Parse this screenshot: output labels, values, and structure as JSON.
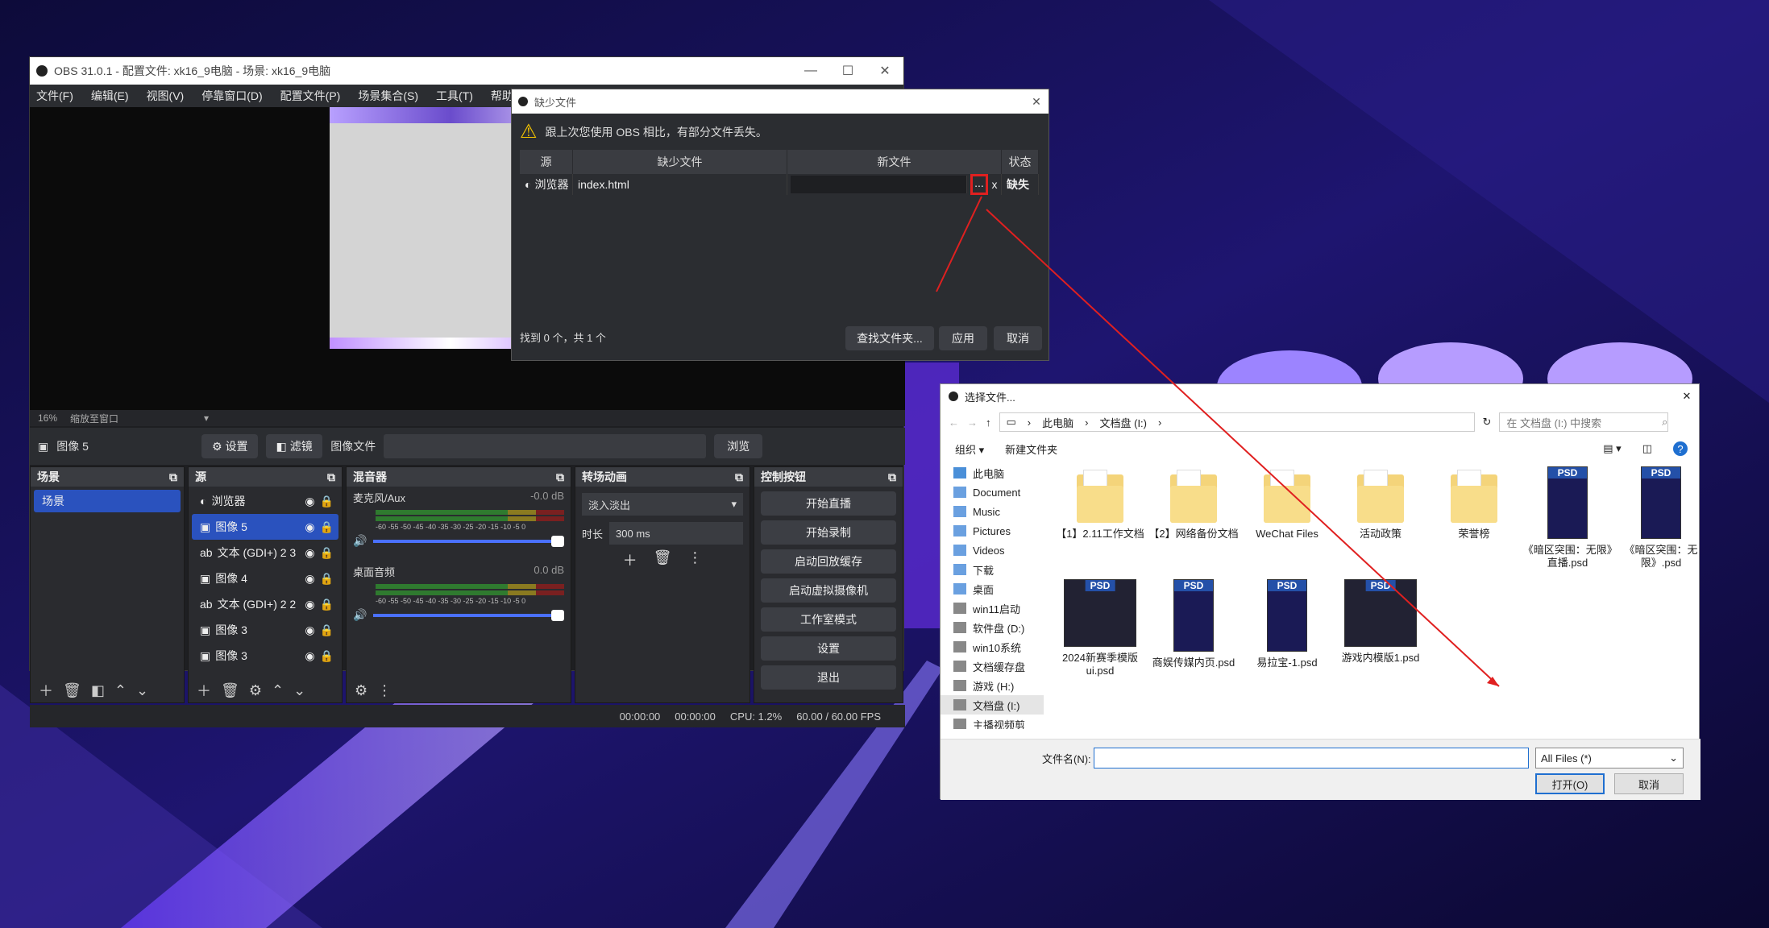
{
  "obs": {
    "title": "OBS 31.0.1 - 配置文件: xk16_9电脑 - 场景: xk16_9电脑",
    "win_min": "—",
    "win_max": "☐",
    "win_close": "✕",
    "menu": [
      "文件(F)",
      "编辑(E)",
      "视图(V)",
      "停靠窗口(D)",
      "配置文件(P)",
      "场景集合(S)",
      "工具(T)",
      "帮助(H)"
    ],
    "zoom": "16%",
    "zoom_mode": "缩放至窗口",
    "selected_source": "图像 5",
    "settings_btn": "设置",
    "filters_btn": "滤镜",
    "image_file_label": "图像文件",
    "browse_btn": "浏览",
    "scenes_title": "场景",
    "scenes": [
      "场景"
    ],
    "sources_title": "源",
    "sources": [
      "浏览器",
      "图像 5",
      "文本 (GDI+) 2 3",
      "图像 4",
      "文本 (GDI+) 2 2",
      "图像 3",
      "图像 3"
    ],
    "mixer_title": "混音器",
    "mixer": [
      {
        "name": "麦克风/Aux",
        "db": "-0.0 dB"
      },
      {
        "name": "桌面音频",
        "db": "0.0 dB"
      }
    ],
    "meter_ticks": "-60 -55 -50 -45 -40 -35 -30 -25 -20 -15 -10 -5 0",
    "transitions_title": "转场动画",
    "transition": "淡入淡出",
    "duration_label": "时长",
    "duration": "300 ms",
    "controls_title": "控制按钮",
    "controls": [
      "开始直播",
      "开始录制",
      "启动回放缓存",
      "启动虚拟摄像机",
      "工作室模式",
      "设置",
      "退出"
    ],
    "status": {
      "live": "00:00:00",
      "rec": "00:00:00",
      "cpu": "CPU: 1.2%",
      "fps": "60.00 / 60.00 FPS"
    }
  },
  "missing": {
    "title": "缺少文件",
    "message": "跟上次您使用 OBS 相比，有部分文件丢失。",
    "headers": [
      "源",
      "缺少文件",
      "新文件",
      "状态"
    ],
    "row": {
      "source": "浏览器",
      "file": "index.html",
      "browse": "...",
      "clear": "x",
      "state": "缺失"
    },
    "found": "找到 0 个，共 1 个",
    "search_btn": "查找文件夹...",
    "apply_btn": "应用",
    "cancel_btn": "取消"
  },
  "filedialog": {
    "title": "选择文件...",
    "path": [
      "此电脑",
      "文档盘 (I:)"
    ],
    "search_placeholder": "在 文档盘 (I:) 中搜索",
    "organize": "组织 ▾",
    "new_folder": "新建文件夹",
    "nav": [
      "此电脑",
      "Document",
      "Music",
      "Pictures",
      "Videos",
      "下载",
      "桌面",
      "win11启动",
      "软件盘 (D:)",
      "win10系统",
      "文档缓存盘",
      "游戏 (H:)",
      "文档盘 (I:)",
      "主播视频剪"
    ],
    "files": [
      {
        "name": "【1】2.11工作文档",
        "kind": "folder"
      },
      {
        "name": "【2】网络备份文档",
        "kind": "folder"
      },
      {
        "name": "WeChat Files",
        "kind": "folder"
      },
      {
        "name": "活动政策",
        "kind": "folder"
      },
      {
        "name": "荣誉榜",
        "kind": "folder"
      },
      {
        "name": "《暗区突围：无限》直播.psd",
        "kind": "psd"
      },
      {
        "name": "《暗区突围：无限》.psd",
        "kind": "psd"
      },
      {
        "name": "2024新赛季模版ui.psd",
        "kind": "psdw"
      },
      {
        "name": "商娱传媒内页.psd",
        "kind": "psd"
      },
      {
        "name": "易拉宝-1.psd",
        "kind": "psd"
      },
      {
        "name": "游戏内模版1.psd",
        "kind": "psdw"
      }
    ],
    "psd_badge": "PSD",
    "filename_label": "文件名(N):",
    "filename": "",
    "filter": "All Files (*)",
    "open_btn": "打开(O)",
    "cancel_btn": "取消"
  },
  "colors": {
    "arrow": "#e02020",
    "accent": "#2a52be"
  }
}
